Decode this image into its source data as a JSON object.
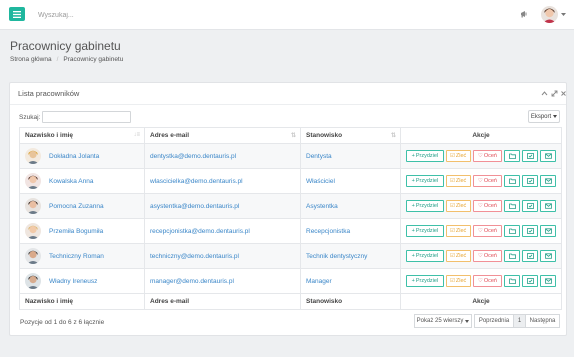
{
  "header": {
    "search_placeholder": "Wyszukaj...",
    "menu_icon": "hamburger-icon",
    "announce_icon": "megaphone-icon",
    "colors": {
      "accent": "#1fb79e",
      "link": "#3a86c8"
    }
  },
  "page": {
    "title": "Pracownicy gabinetu",
    "breadcrumb": [
      "Strona główna",
      "Pracownicy gabinetu"
    ]
  },
  "panel": {
    "title": "Lista pracowników",
    "filter_label": "Szukaj:",
    "export_label": "Eksport",
    "columns": [
      "Nazwisko i imię",
      "Adres e-mail",
      "Stanowisko",
      "Akcje"
    ],
    "action_labels": {
      "assign": "Przydziel",
      "order": "Zleć",
      "rate": "Oceń"
    },
    "rows": [
      {
        "name": "Dokładna Jolanta",
        "email": "dentystka@demo.dentauris.pl",
        "position": "Dentysta"
      },
      {
        "name": "Kowalska Anna",
        "email": "wlascicielka@demo.dentauris.pl",
        "position": "Właściciel"
      },
      {
        "name": "Pomocna Zuzanna",
        "email": "asystentka@demo.dentauris.pl",
        "position": "Asystentka"
      },
      {
        "name": "Przemiła Bogumiła",
        "email": "recepcjonistka@demo.dentauris.pl",
        "position": "Recepcjonistka"
      },
      {
        "name": "Techniczny Roman",
        "email": "techniczny@demo.dentauris.pl",
        "position": "Technik dentystyczny"
      },
      {
        "name": "Władny Ireneusz",
        "email": "manager@demo.dentauris.pl",
        "position": "Manager"
      }
    ],
    "info": "Pozycje od 1 do 6 z 6 łącznie",
    "pagination": {
      "page_size": "Pokaż 25 wierszy",
      "prev": "Poprzednia",
      "current": "1",
      "next": "Następna"
    }
  }
}
